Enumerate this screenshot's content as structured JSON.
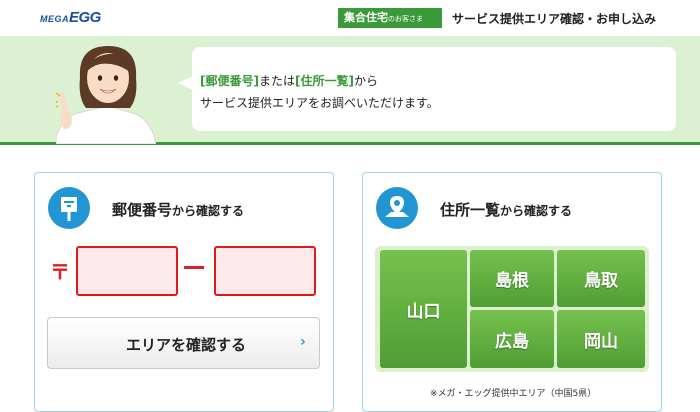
{
  "header": {
    "logo_prefix": "MEGA",
    "logo_main": "EGG",
    "badge_label": "集合住宅",
    "badge_suffix": "のお客さま",
    "title": "サービス提供エリア確認・お申し込み"
  },
  "hero": {
    "bubble": {
      "hl1": "[郵便番号]",
      "text1": "または",
      "hl2": "[住所一覧]",
      "text2": "から",
      "line2": "サービス提供エリアをお調べいただけます。"
    }
  },
  "postal_card": {
    "title_main": "郵便番号",
    "title_suffix": "から確認する",
    "postal_mark": "〒",
    "zip_first_value": "",
    "zip_second_value": "",
    "button_label": "エリアを確認する",
    "button_chevron": "›",
    "icon": "postbox-icon"
  },
  "address_card": {
    "title_main": "住所一覧",
    "title_suffix": "から確認する",
    "icon": "map-pin-icon",
    "prefectures": {
      "yamaguchi": "山口",
      "shimane": "島根",
      "tottori": "鳥取",
      "hiroshima": "広島",
      "okayama": "岡山"
    },
    "note": "※メガ・エッグ提供中エリア（中国5県）"
  },
  "colors": {
    "brand_green": "#3a9a3a",
    "hero_bg": "#dcf0d2",
    "accent_blue": "#2196d3",
    "card_border": "#9dd3ef",
    "input_red": "#e01a1a",
    "input_bg": "#fde8ec",
    "logo_blue": "#1a4fa0"
  }
}
